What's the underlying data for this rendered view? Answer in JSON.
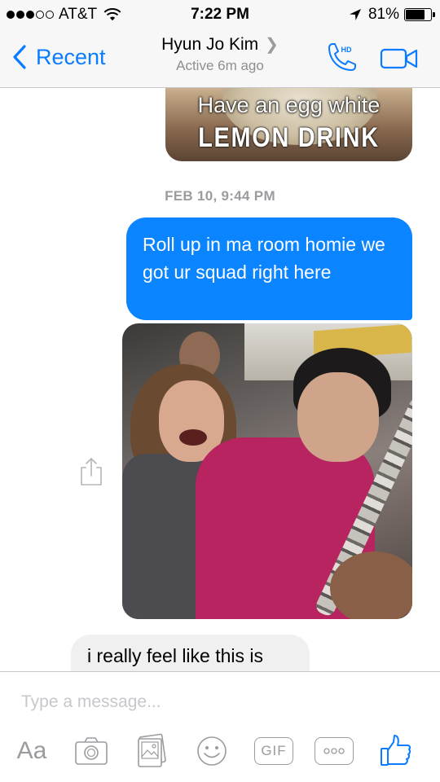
{
  "status_bar": {
    "carrier": "AT&T",
    "time": "7:22 PM",
    "battery_pct": "81%",
    "battery_level": 0.81,
    "signal_dots_filled": 3,
    "signal_dots_total": 5
  },
  "header": {
    "back_label": "Recent",
    "contact_name": "Hyun Jo Kim",
    "active_status": "Active 6m ago",
    "call_badge": "HD",
    "accent_color": "#0a7cff"
  },
  "conversation": {
    "earlier_photo": {
      "caption_line1": "Have an egg white",
      "caption_line2": "LEMON DRINK"
    },
    "date_separator": "FEB 10, 9:44 PM",
    "outgoing_message": "Roll up in ma room homie we got ur squad right here",
    "outgoing_color": "#0a84ff",
    "incoming_message": "i really feel like this is"
  },
  "composer": {
    "placeholder": "Type a message...",
    "tools": {
      "text_label": "Aa",
      "gif_label": "GIF"
    },
    "icons": [
      "text-format-icon",
      "camera-icon",
      "gallery-icon",
      "smiley-icon",
      "gif-icon",
      "more-icon",
      "thumbs-up-icon"
    ]
  }
}
